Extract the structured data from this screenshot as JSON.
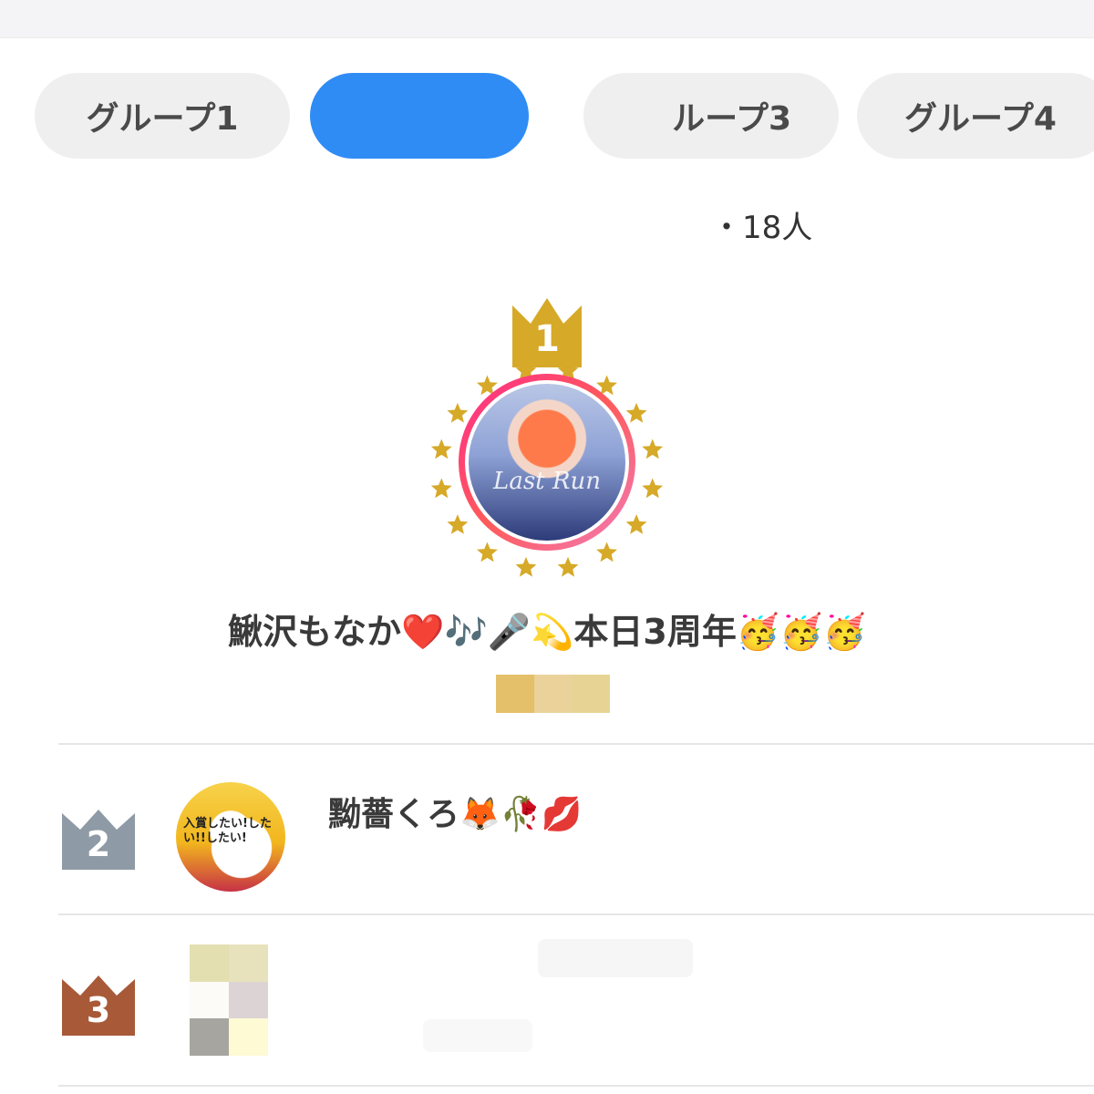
{
  "tabs": [
    {
      "label": "グループ1"
    },
    {
      "label": ""
    },
    {
      "label": "ループ3"
    },
    {
      "label": "グループ4"
    }
  ],
  "member_count": "・18人",
  "first_place": {
    "rank": "1",
    "name": "鰍沢もなか❤️🎶🎤💫本日3周年🥳🥳🥳",
    "avatar_art_text": "Last Run"
  },
  "second_place": {
    "rank": "2",
    "name": "黝薔くろ🦊🥀💋",
    "avatar_text": "入賞したい!したい!!したい!"
  },
  "third_place": {
    "rank": "3"
  },
  "colors": {
    "gold": "#d6a928",
    "silver": "#8e9aa5",
    "bronze": "#a85a38",
    "active_tab": "#2f8cf5",
    "banner": "#ff7a00"
  }
}
